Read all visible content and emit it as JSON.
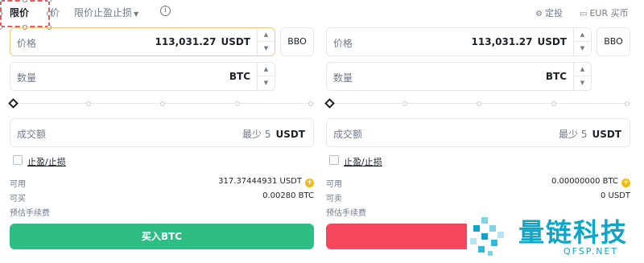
{
  "tabs": {
    "limit": "限价",
    "market_partial": "价",
    "stop_limit": "限价止盈止损"
  },
  "top_right": {
    "lock_label": "定投",
    "currency_label": "EUR 买币"
  },
  "buy": {
    "price_label": "价格",
    "price_value": "113,031.27",
    "price_unit": "USDT",
    "bbo_label": "BBO",
    "qty_label": "数量",
    "qty_unit": "BTC",
    "total_label": "成交额",
    "total_min": "最少 5",
    "total_unit": "USDT",
    "tpsl_label": "止盈/止损",
    "available_label": "可用",
    "available_value": "317.37444931 USDT",
    "can_buy_label": "可买",
    "can_buy_value": "0.00280 BTC",
    "fee_label": "预估手续费",
    "action_label": "买入BTC"
  },
  "sell": {
    "price_label": "价格",
    "price_value": "113,031.27",
    "price_unit": "USDT",
    "bbo_label": "BBO",
    "qty_label": "数量",
    "qty_unit": "BTC",
    "total_label": "成交额",
    "total_min": "最少 5",
    "total_unit": "USDT",
    "tpsl_label": "止盈/止损",
    "available_label": "可用",
    "available_value": "0.00000000 BTC",
    "can_sell_label": "可卖",
    "can_sell_value": "0 USDT",
    "fee_label": "预估手续费",
    "action_label": "卖"
  },
  "watermark": {
    "text": "量链科技",
    "sub": "QFSP.NET"
  },
  "colors": {
    "buy": "#2ebd85",
    "sell": "#f6465d",
    "accent": "#f0b90b",
    "watermark": "#0fa5c7"
  }
}
